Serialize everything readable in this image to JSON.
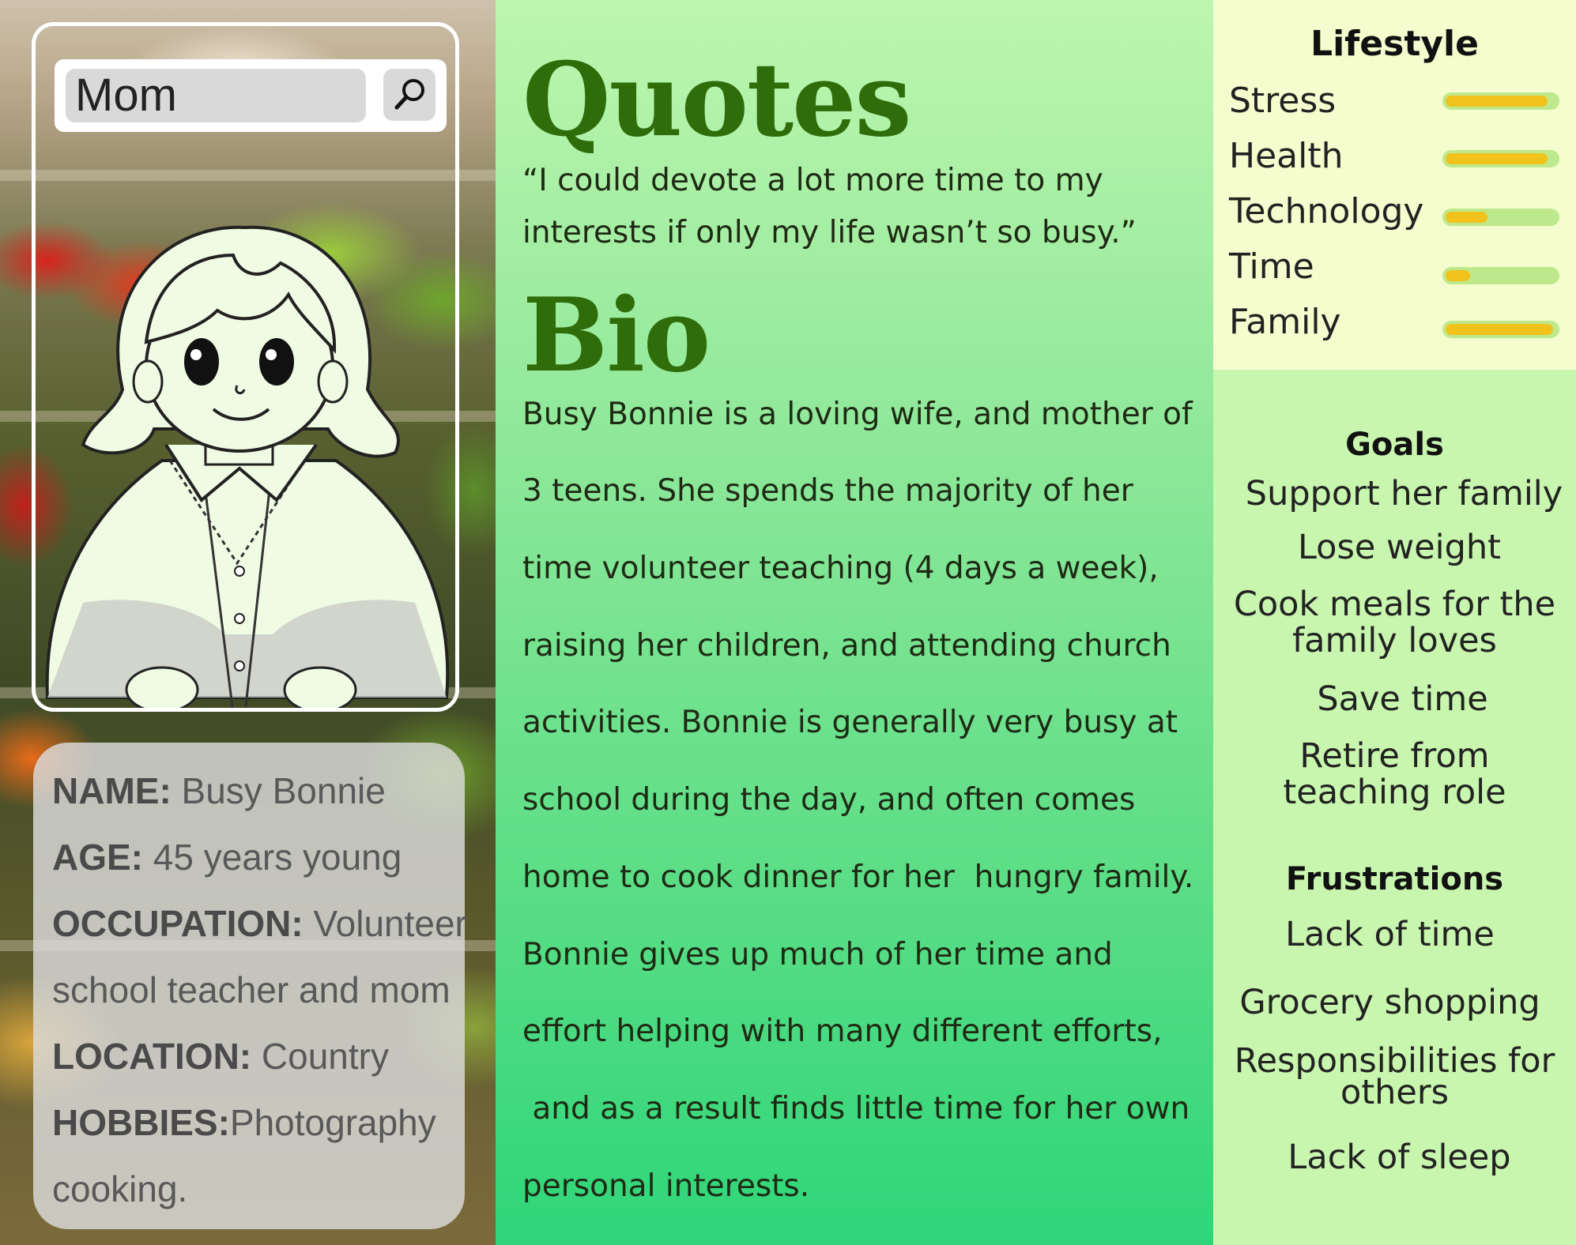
{
  "search": {
    "value": "Mom"
  },
  "info": {
    "name_label": "NAME:",
    "name_value": " Busy Bonnie",
    "age_label": "AGE:",
    "age_value": " 45 years young",
    "occupation_label": "OCCUPATION:",
    "occupation_value": " Volunteer",
    "occupation_value_2": "school teacher and mom",
    "location_label": "LOCATION:",
    "location_value": " Country",
    "hobbies_label": "HOBBIES:",
    "hobbies_value": "Photography",
    "hobbies_value_2": "cooking."
  },
  "quotes": {
    "heading": "Quotes",
    "text": "“I could devote a lot more time to my interests if only my life wasn’t so busy.”"
  },
  "bio": {
    "heading": "Bio",
    "lines": [
      "Busy Bonnie is a loving wife, and mother of",
      "3 teens. She spends the majority of her",
      "time volunteer teaching (4 days a week),",
      "raising her children, and attending church",
      "activities. Bonnie is generally very busy at",
      "school during the day, and often comes",
      "home to cook dinner for her  hungry family.",
      "Bonnie gives up much of her time and",
      "effort helping with many different efforts,",
      " and as a result finds little time for her own",
      "personal interests."
    ]
  },
  "lifestyle": {
    "heading": "Lifestyle",
    "items": [
      {
        "label": "Stress",
        "level": 0.92
      },
      {
        "label": "Health",
        "level": 0.92
      },
      {
        "label": "Technology",
        "level": 0.38
      },
      {
        "label": "Time",
        "level": 0.22
      },
      {
        "label": "Family",
        "level": 0.97
      }
    ],
    "track_color": "#bde98c",
    "fill_color": "#f2c21c"
  },
  "goals": {
    "heading": "Goals",
    "items": [
      "Support her family",
      "Lose weight",
      "Cook meals for the",
      "family loves",
      "Save time",
      "Retire from",
      "teaching role"
    ]
  },
  "frustrations": {
    "heading": "Frustrations",
    "items": [
      "Lack of time",
      "Grocery shopping",
      "Responsibilities for",
      "others",
      "Lack of sleep"
    ]
  },
  "colors": {
    "heading_green": "#2f6c0a",
    "middle_top": "#bdf6ae",
    "middle_bottom": "#2ed679",
    "lifestyle_bg": "#f5fcce",
    "right_bg": "#c8f6ae"
  }
}
